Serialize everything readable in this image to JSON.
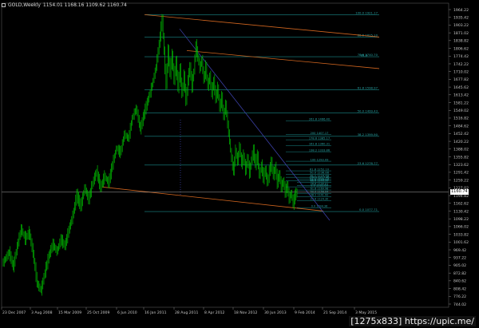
{
  "header": {
    "symbol_label": "GOLD,Weekly",
    "ohlc": "1154.01 1168.16 1109.62 1160.74"
  },
  "watermark": "[1275x833] https://upic.me/",
  "current_price": "1160.74",
  "colors": {
    "background": "#000000",
    "candles": "#00c000",
    "fib_levels": "#1a8a8a",
    "fib_labels": "#2aa4a4",
    "channel_lines": "#d0651f",
    "trend_line": "#3a3fa3",
    "grid_dots": "#3a3a3a",
    "axis_text": "#c8c8c8",
    "current_price_line": "#d8d8d8"
  },
  "chart_data": {
    "type": "candlestick",
    "timeframe": "Weekly",
    "symbol": "GOLD",
    "y_ticks": [
      1964.22,
      1930.12,
      1895.92,
      1861.82,
      1827.62,
      1793.52,
      1759.32,
      1725.22,
      1691.02,
      1656.92,
      1622.72,
      1588.62,
      1554.42,
      1520.32,
      1486.12,
      1452.02,
      1417.82,
      1383.72,
      1349.52,
      1315.42,
      1281.22,
      1247.12,
      1212.92,
      1178.82,
      1144.62,
      1110.52,
      1076.32,
      1042.22,
      1008.02,
      973.92,
      939.72,
      905.62,
      871.42,
      837.32,
      803.12,
      769.02,
      734.82,
      700.72,
      666.52
    ],
    "y_tick_labels": [
      "1964.22",
      "1935.42",
      "1903.22",
      "1871.02",
      "1838.82",
      "1806.62",
      "1774.42",
      "1742.22",
      "1710.02",
      "1677.82",
      "1645.62",
      "1613.42",
      "1581.22",
      "1549.02",
      "1516.82",
      "1484.62",
      "1452.42",
      "1420.22",
      "1388.02",
      "1355.82",
      "1323.62",
      "1291.42",
      "1259.22",
      "1227.02",
      "1194.82",
      "1162.62",
      "1130.42",
      "1098.22",
      "1066.02",
      "1033.82",
      "1001.62",
      "969.42",
      "937.22",
      "905.02",
      "872.82",
      "840.62",
      "808.42",
      "776.22",
      "744.02"
    ],
    "x_labels": [
      "23 Dec 2007",
      "3 Aug 2008",
      "15 Mar 2009",
      "25 Oct 2009",
      "6 Jun 2010",
      "16 Jan 2011",
      "28 Aug 2011",
      "8 Apr 2012",
      "18 Nov 2012",
      "30 Jun 2013",
      "9 Feb 2014",
      "21 Sep 2014",
      "3 May 2015"
    ],
    "ylim": [
      668.0,
      1970.0
    ],
    "price_series": [
      [
        0,
        860
      ],
      [
        6,
        905
      ],
      [
        10,
        840
      ],
      [
        14,
        930
      ],
      [
        18,
        1005
      ],
      [
        22,
        960
      ],
      [
        26,
        990
      ],
      [
        30,
        900
      ],
      [
        34,
        770
      ],
      [
        38,
        740
      ],
      [
        42,
        820
      ],
      [
        46,
        890
      ],
      [
        50,
        940
      ],
      [
        54,
        905
      ],
      [
        58,
        960
      ],
      [
        62,
        930
      ],
      [
        66,
        1000
      ],
      [
        70,
        1060
      ],
      [
        74,
        1150
      ],
      [
        78,
        1100
      ],
      [
        82,
        1180
      ],
      [
        86,
        1130
      ],
      [
        90,
        1200
      ],
      [
        94,
        1250
      ],
      [
        98,
        1180
      ],
      [
        102,
        1230
      ],
      [
        106,
        1200
      ],
      [
        110,
        1280
      ],
      [
        114,
        1350
      ],
      [
        118,
        1330
      ],
      [
        122,
        1410
      ],
      [
        126,
        1390
      ],
      [
        130,
        1480
      ],
      [
        134,
        1520
      ],
      [
        138,
        1430
      ],
      [
        142,
        1500
      ],
      [
        146,
        1560
      ],
      [
        150,
        1620
      ],
      [
        154,
        1700
      ],
      [
        158,
        1830
      ],
      [
        160,
        1905
      ],
      [
        162,
        1760
      ],
      [
        164,
        1620
      ],
      [
        166,
        1770
      ],
      [
        168,
        1670
      ],
      [
        170,
        1750
      ],
      [
        172,
        1640
      ],
      [
        174,
        1720
      ],
      [
        176,
        1610
      ],
      [
        178,
        1690
      ],
      [
        180,
        1580
      ],
      [
        182,
        1660
      ],
      [
        184,
        1550
      ],
      [
        186,
        1640
      ],
      [
        188,
        1700
      ],
      [
        190,
        1610
      ],
      [
        192,
        1680
      ],
      [
        194,
        1790
      ],
      [
        196,
        1740
      ],
      [
        198,
        1690
      ],
      [
        200,
        1730
      ],
      [
        202,
        1640
      ],
      [
        204,
        1700
      ],
      [
        206,
        1610
      ],
      [
        208,
        1660
      ],
      [
        210,
        1580
      ],
      [
        212,
        1640
      ],
      [
        214,
        1560
      ],
      [
        216,
        1610
      ],
      [
        218,
        1520
      ],
      [
        220,
        1570
      ],
      [
        222,
        1480
      ],
      [
        224,
        1540
      ],
      [
        226,
        1450
      ],
      [
        228,
        1380
      ],
      [
        230,
        1300
      ],
      [
        232,
        1250
      ],
      [
        234,
        1340
      ],
      [
        236,
        1290
      ],
      [
        238,
        1360
      ],
      [
        240,
        1280
      ],
      [
        242,
        1320
      ],
      [
        244,
        1250
      ],
      [
        246,
        1310
      ],
      [
        248,
        1240
      ],
      [
        250,
        1300
      ],
      [
        252,
        1340
      ],
      [
        254,
        1280
      ],
      [
        256,
        1320
      ],
      [
        258,
        1230
      ],
      [
        260,
        1280
      ],
      [
        262,
        1220
      ],
      [
        264,
        1260
      ],
      [
        266,
        1200
      ],
      [
        268,
        1250
      ],
      [
        270,
        1290
      ],
      [
        272,
        1230
      ],
      [
        274,
        1270
      ],
      [
        276,
        1200
      ],
      [
        278,
        1240
      ],
      [
        280,
        1180
      ],
      [
        282,
        1210
      ],
      [
        284,
        1160
      ],
      [
        286,
        1190
      ],
      [
        288,
        1130
      ],
      [
        290,
        1160
      ],
      [
        292,
        1110
      ],
      [
        294,
        1150
      ],
      [
        296,
        1160
      ]
    ],
    "fib_levels": [
      {
        "label": "100.0 1921.17",
        "price": 1921.17
      },
      {
        "label": "88.6 1825.10",
        "price": 1825.1
      },
      {
        "label": "78.6 1740.70",
        "price": 1740.7
      },
      {
        "label": "61.8 1598.97",
        "price": 1598.97
      },
      {
        "label": "50.0 1499.43",
        "price": 1499.43
      },
      {
        "label": "38.2 1399.90",
        "price": 1399.9
      },
      {
        "label": "23.6 1276.77",
        "price": 1276.77
      },
      {
        "label": "0.0 1077.71",
        "price": 1077.71
      }
    ],
    "fib_marker_left": "100.0",
    "fib_marker_mid": "61.8",
    "projection_levels": [
      {
        "label": "261.8 1466.40",
        "price": 1466.4
      },
      {
        "label": "200 1407.17",
        "price": 1407.17
      },
      {
        "label": "178.6 1385.17",
        "price": 1385.17
      },
      {
        "label": "161.8 1360.31",
        "price": 1360.31
      },
      {
        "label": "138.2 1333.86",
        "price": 1333.86
      },
      {
        "label": "100 1293.09",
        "price": 1293.09
      },
      {
        "label": "61.8 1252.10",
        "price": 1252.1
      },
      {
        "label": "50.0 1236.88",
        "price": 1236.88
      },
      {
        "label": "38.2 1224.48",
        "price": 1224.48
      },
      {
        "label": "23.6 1209.03",
        "price": 1209.03
      },
      {
        "label": "0.0 1183.60",
        "price": 1183.6
      }
    ],
    "lower_levels": [
      {
        "label": "100.0 1217.40",
        "price": 1217.4
      },
      {
        "label": "88.6 1203.55",
        "price": 1203.55
      },
      {
        "label": "78.6 1190.01",
        "price": 1190.01
      },
      {
        "label": "61.8 1169.98",
        "price": 1169.98
      },
      {
        "label": "50.0 1156.04",
        "price": 1156.04
      },
      {
        "label": "38.2 1141.92",
        "price": 1141.92
      },
      {
        "label": "23.6 1124.30",
        "price": 1124.3
      },
      {
        "label": "0.0 1094.36",
        "price": 1094.36
      }
    ]
  }
}
